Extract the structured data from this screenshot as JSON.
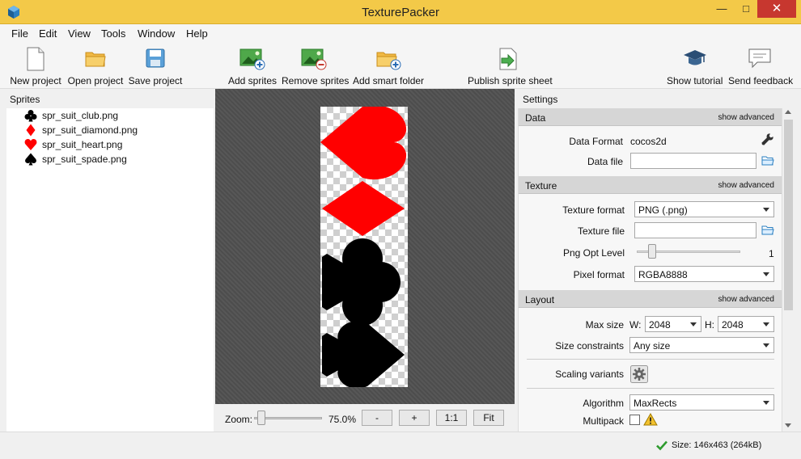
{
  "window": {
    "title": "TexturePacker"
  },
  "menu": [
    {
      "label": "File"
    },
    {
      "label": "Edit"
    },
    {
      "label": "View"
    },
    {
      "label": "Tools"
    },
    {
      "label": "Window"
    },
    {
      "label": "Help"
    }
  ],
  "toolbar": {
    "new_project": "New project",
    "open_project": "Open project",
    "save_project": "Save project",
    "add_sprites": "Add sprites",
    "remove_sprites": "Remove sprites",
    "add_smart_folder": "Add smart folder",
    "publish": "Publish sprite sheet",
    "tutorial": "Show tutorial",
    "feedback": "Send feedback"
  },
  "sprites": {
    "header": "Sprites",
    "items": [
      {
        "name": "spr_suit_club.png",
        "icon": "club-icon",
        "color": "#000000"
      },
      {
        "name": "spr_suit_diamond.png",
        "icon": "diamond-icon",
        "color": "#ff0000"
      },
      {
        "name": "spr_suit_heart.png",
        "icon": "heart-icon",
        "color": "#ff0000"
      },
      {
        "name": "spr_suit_spade.png",
        "icon": "spade-icon",
        "color": "#000000"
      }
    ]
  },
  "zoom": {
    "label": "Zoom:",
    "value": "75.0%",
    "minus": "-",
    "plus": "+",
    "one_to_one": "1:1",
    "fit": "Fit"
  },
  "settings": {
    "header": "Settings",
    "show_advanced": "show advanced",
    "data": {
      "title": "Data",
      "format_label": "Data Format",
      "format_value": "cocos2d",
      "file_label": "Data file",
      "file_value": ""
    },
    "texture": {
      "title": "Texture",
      "format_label": "Texture format",
      "format_value": "PNG (.png)",
      "file_label": "Texture file",
      "file_value": "",
      "opt_label": "Png Opt Level",
      "opt_value": "1",
      "pixel_label": "Pixel format",
      "pixel_value": "RGBA8888"
    },
    "layout": {
      "title": "Layout",
      "max_size_label": "Max size",
      "w_label": "W:",
      "w_value": "2048",
      "h_label": "H:",
      "h_value": "2048",
      "constraints_label": "Size constraints",
      "constraints_value": "Any size",
      "scaling_label": "Scaling variants",
      "algorithm_label": "Algorithm",
      "algorithm_value": "MaxRects",
      "multipack_label": "Multipack"
    }
  },
  "status": {
    "text": "Size: 146x463 (264kB)"
  },
  "colors": {
    "titlebar": "#f3c948",
    "close": "#c7372f",
    "suit_red": "#ff0000",
    "suit_black": "#000000",
    "ok": "#2e9b2e"
  }
}
